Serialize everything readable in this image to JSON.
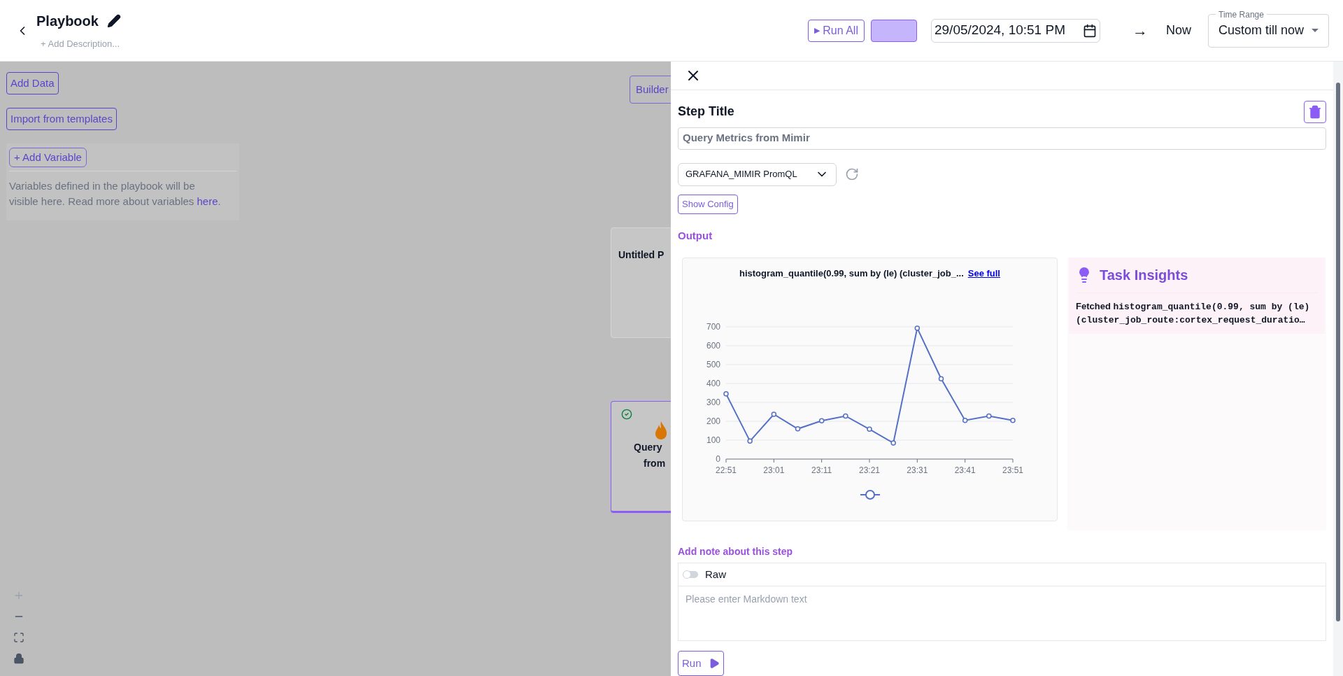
{
  "header": {
    "title": "Playbook",
    "description_placeholder": "+ Add Description...",
    "run_all": "Run All",
    "run_all_icon": "▶",
    "start_time": "29/05/2024, 10:51 PM",
    "arrow": "→",
    "end_time": "Now",
    "time_range": {
      "label": "Time Range",
      "value": "Custom till now"
    }
  },
  "canvas": {
    "add_data": "Add Data",
    "import_templates": "Import from templates",
    "add_variable": "+ Add Variable",
    "variables_note": "Variables defined in the playbook will be visible here. Read more about variables ",
    "variables_link": "here",
    "variables_end": ".",
    "builder": "Builder",
    "nodes": [
      {
        "title": [
          "Untitled P"
        ],
        "done": false,
        "selected": false
      },
      {
        "title": [
          "Query",
          "from"
        ],
        "done": true,
        "selected": true
      }
    ]
  },
  "drawer": {
    "step_title_label": "Step Title",
    "step_title": "Query Metrics from Mimir",
    "source": "GRAFANA_MIMIR PromQL",
    "show_config": "Show Config",
    "output_label": "Output",
    "chart_title": "histogram_quantile(0.99, sum by (le) (cluster_job_...",
    "see_full": "See full",
    "chart_data": {
      "type": "line",
      "categories": [
        "22:51",
        null,
        "23:01",
        null,
        "23:11",
        null,
        "23:21",
        null,
        "23:31",
        null,
        "23:41",
        null,
        "23:51"
      ],
      "grid": true,
      "series": [
        {
          "color": "#5470c6",
          "marker": "circle",
          "values": [
            345,
            95,
            237,
            160,
            203,
            228,
            158,
            85,
            693,
            425,
            205,
            228,
            205
          ]
        }
      ],
      "yticks": [
        0,
        100,
        200,
        300,
        400,
        500,
        600,
        700
      ],
      "ylim": [
        0,
        700
      ]
    },
    "insights": {
      "title": "Task Insights",
      "prefix": "Fetched",
      "text": "histogram_quantile(0.99, sum by (le) (cluster_job_route:cortex_request_duratio…"
    },
    "note_label": "Add note about this step",
    "raw": {
      "label": "Raw",
      "on": false
    },
    "note_placeholder": "Please enter Markdown text",
    "run": "Run"
  }
}
